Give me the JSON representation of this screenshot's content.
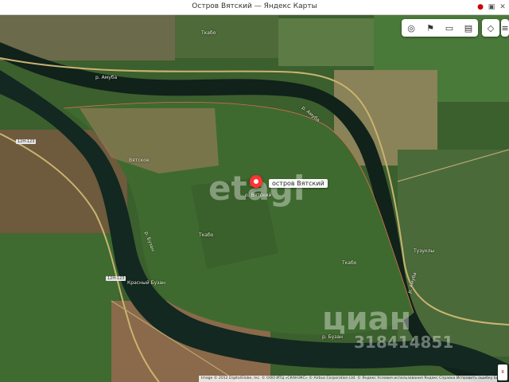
{
  "window": {
    "title": "Остров Вятский — Яндекс Карты"
  },
  "toolbar": {
    "icons": [
      "layers-icon",
      "panorama-icon",
      "photo-icon",
      "transit-icon"
    ]
  },
  "controls": {
    "route_icon": "route-icon",
    "menu_icon": "menu-icon"
  },
  "place": {
    "name": "остров Вятский",
    "map_label": "о. Вятский"
  },
  "labels": {
    "river_amuba_1": "р. Амуба",
    "river_amuba_2": "р. Амуба",
    "river_amuba_3": "р. Амуба",
    "river_buzan_1": "р. Бузан",
    "river_buzan_2": "р. Бузан",
    "village_vyatskoe": "Вятское",
    "village_krasny_buzan": "Красный Бузан",
    "village_tuzukly": "Тузуклы",
    "field_1": "Ткабо",
    "field_2": "Ткабо",
    "field_3": "Ткабо",
    "road_1": "12Н-123",
    "road_2": "12Н-123"
  },
  "watermarks": {
    "etagi": "etagi",
    "cian": "циан",
    "id_number": "318414851"
  },
  "footer": {
    "attribution": "Image © 2012 DigitalGlobe, Inc. © ООО ИТЦ «СКАНЭКС» © Airbus Corporation Ltd. © Яндекс  Условия использования  Яндекс  Справка  Исправить ошибку  Бизнес Статистика"
  },
  "colors": {
    "water": "#10221a",
    "field": "#3f6a2f",
    "farmland": "#8e7a55",
    "accent_red": "#ff3333"
  }
}
